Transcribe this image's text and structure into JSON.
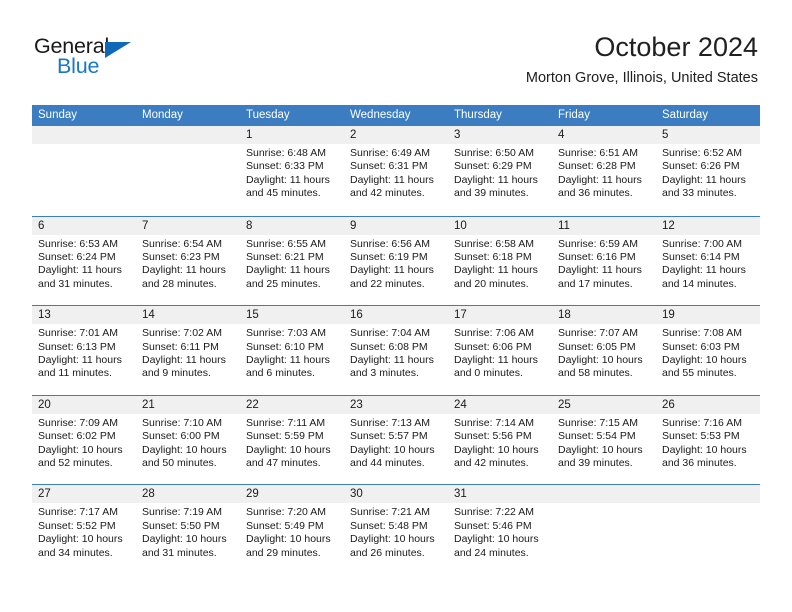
{
  "brand": {
    "name_part1": "General",
    "name_part2": "Blue",
    "color_primary": "#1878c8",
    "color_dark": "#1a1a1a"
  },
  "header": {
    "title": "October 2024",
    "subtitle": "Morton Grove, Illinois, United States"
  },
  "theme": {
    "header_blue": "#3b7dc0",
    "day_band_gray": "#f0f0f0"
  },
  "weekdays": [
    "Sunday",
    "Monday",
    "Tuesday",
    "Wednesday",
    "Thursday",
    "Friday",
    "Saturday"
  ],
  "labels": {
    "sunrise_prefix": "Sunrise:",
    "sunset_prefix": "Sunset:",
    "daylight_prefix": "Daylight:"
  },
  "weeks": [
    [
      {
        "day": "",
        "sunrise": "",
        "sunset": "",
        "daylight": "",
        "empty": true
      },
      {
        "day": "",
        "sunrise": "",
        "sunset": "",
        "daylight": "",
        "empty": true
      },
      {
        "day": "1",
        "sunrise": "Sunrise: 6:48 AM",
        "sunset": "Sunset: 6:33 PM",
        "daylight": "Daylight: 11 hours and 45 minutes."
      },
      {
        "day": "2",
        "sunrise": "Sunrise: 6:49 AM",
        "sunset": "Sunset: 6:31 PM",
        "daylight": "Daylight: 11 hours and 42 minutes."
      },
      {
        "day": "3",
        "sunrise": "Sunrise: 6:50 AM",
        "sunset": "Sunset: 6:29 PM",
        "daylight": "Daylight: 11 hours and 39 minutes."
      },
      {
        "day": "4",
        "sunrise": "Sunrise: 6:51 AM",
        "sunset": "Sunset: 6:28 PM",
        "daylight": "Daylight: 11 hours and 36 minutes."
      },
      {
        "day": "5",
        "sunrise": "Sunrise: 6:52 AM",
        "sunset": "Sunset: 6:26 PM",
        "daylight": "Daylight: 11 hours and 33 minutes."
      }
    ],
    [
      {
        "day": "6",
        "sunrise": "Sunrise: 6:53 AM",
        "sunset": "Sunset: 6:24 PM",
        "daylight": "Daylight: 11 hours and 31 minutes."
      },
      {
        "day": "7",
        "sunrise": "Sunrise: 6:54 AM",
        "sunset": "Sunset: 6:23 PM",
        "daylight": "Daylight: 11 hours and 28 minutes."
      },
      {
        "day": "8",
        "sunrise": "Sunrise: 6:55 AM",
        "sunset": "Sunset: 6:21 PM",
        "daylight": "Daylight: 11 hours and 25 minutes."
      },
      {
        "day": "9",
        "sunrise": "Sunrise: 6:56 AM",
        "sunset": "Sunset: 6:19 PM",
        "daylight": "Daylight: 11 hours and 22 minutes."
      },
      {
        "day": "10",
        "sunrise": "Sunrise: 6:58 AM",
        "sunset": "Sunset: 6:18 PM",
        "daylight": "Daylight: 11 hours and 20 minutes."
      },
      {
        "day": "11",
        "sunrise": "Sunrise: 6:59 AM",
        "sunset": "Sunset: 6:16 PM",
        "daylight": "Daylight: 11 hours and 17 minutes."
      },
      {
        "day": "12",
        "sunrise": "Sunrise: 7:00 AM",
        "sunset": "Sunset: 6:14 PM",
        "daylight": "Daylight: 11 hours and 14 minutes."
      }
    ],
    [
      {
        "day": "13",
        "sunrise": "Sunrise: 7:01 AM",
        "sunset": "Sunset: 6:13 PM",
        "daylight": "Daylight: 11 hours and 11 minutes."
      },
      {
        "day": "14",
        "sunrise": "Sunrise: 7:02 AM",
        "sunset": "Sunset: 6:11 PM",
        "daylight": "Daylight: 11 hours and 9 minutes."
      },
      {
        "day": "15",
        "sunrise": "Sunrise: 7:03 AM",
        "sunset": "Sunset: 6:10 PM",
        "daylight": "Daylight: 11 hours and 6 minutes."
      },
      {
        "day": "16",
        "sunrise": "Sunrise: 7:04 AM",
        "sunset": "Sunset: 6:08 PM",
        "daylight": "Daylight: 11 hours and 3 minutes."
      },
      {
        "day": "17",
        "sunrise": "Sunrise: 7:06 AM",
        "sunset": "Sunset: 6:06 PM",
        "daylight": "Daylight: 11 hours and 0 minutes."
      },
      {
        "day": "18",
        "sunrise": "Sunrise: 7:07 AM",
        "sunset": "Sunset: 6:05 PM",
        "daylight": "Daylight: 10 hours and 58 minutes."
      },
      {
        "day": "19",
        "sunrise": "Sunrise: 7:08 AM",
        "sunset": "Sunset: 6:03 PM",
        "daylight": "Daylight: 10 hours and 55 minutes."
      }
    ],
    [
      {
        "day": "20",
        "sunrise": "Sunrise: 7:09 AM",
        "sunset": "Sunset: 6:02 PM",
        "daylight": "Daylight: 10 hours and 52 minutes."
      },
      {
        "day": "21",
        "sunrise": "Sunrise: 7:10 AM",
        "sunset": "Sunset: 6:00 PM",
        "daylight": "Daylight: 10 hours and 50 minutes."
      },
      {
        "day": "22",
        "sunrise": "Sunrise: 7:11 AM",
        "sunset": "Sunset: 5:59 PM",
        "daylight": "Daylight: 10 hours and 47 minutes."
      },
      {
        "day": "23",
        "sunrise": "Sunrise: 7:13 AM",
        "sunset": "Sunset: 5:57 PM",
        "daylight": "Daylight: 10 hours and 44 minutes."
      },
      {
        "day": "24",
        "sunrise": "Sunrise: 7:14 AM",
        "sunset": "Sunset: 5:56 PM",
        "daylight": "Daylight: 10 hours and 42 minutes."
      },
      {
        "day": "25",
        "sunrise": "Sunrise: 7:15 AM",
        "sunset": "Sunset: 5:54 PM",
        "daylight": "Daylight: 10 hours and 39 minutes."
      },
      {
        "day": "26",
        "sunrise": "Sunrise: 7:16 AM",
        "sunset": "Sunset: 5:53 PM",
        "daylight": "Daylight: 10 hours and 36 minutes."
      }
    ],
    [
      {
        "day": "27",
        "sunrise": "Sunrise: 7:17 AM",
        "sunset": "Sunset: 5:52 PM",
        "daylight": "Daylight: 10 hours and 34 minutes."
      },
      {
        "day": "28",
        "sunrise": "Sunrise: 7:19 AM",
        "sunset": "Sunset: 5:50 PM",
        "daylight": "Daylight: 10 hours and 31 minutes."
      },
      {
        "day": "29",
        "sunrise": "Sunrise: 7:20 AM",
        "sunset": "Sunset: 5:49 PM",
        "daylight": "Daylight: 10 hours and 29 minutes."
      },
      {
        "day": "30",
        "sunrise": "Sunrise: 7:21 AM",
        "sunset": "Sunset: 5:48 PM",
        "daylight": "Daylight: 10 hours and 26 minutes."
      },
      {
        "day": "31",
        "sunrise": "Sunrise: 7:22 AM",
        "sunset": "Sunset: 5:46 PM",
        "daylight": "Daylight: 10 hours and 24 minutes."
      },
      {
        "day": "",
        "sunrise": "",
        "sunset": "",
        "daylight": "",
        "empty": true
      },
      {
        "day": "",
        "sunrise": "",
        "sunset": "",
        "daylight": "",
        "empty": true
      }
    ]
  ]
}
